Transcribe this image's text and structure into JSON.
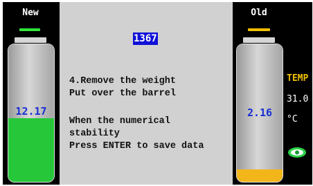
{
  "left_panel": {
    "label": "New",
    "value": "12.17",
    "fill_fraction": 0.46,
    "indicator_color": "#2ee63a",
    "fill_color": "#27c73a",
    "value_color": "#1a2fd4"
  },
  "right_panel": {
    "label": "Old",
    "value": "2.16",
    "fill_fraction": 0.09,
    "indicator_color": "#f0c000",
    "fill_color": "#f3b61a",
    "value_color": "#1a2fd4"
  },
  "center": {
    "counter": "1367",
    "instructions": [
      "4.Remove the weight",
      "Put over the barrel",
      "When the numerical",
      "stability",
      "Press ENTER to save data"
    ]
  },
  "side": {
    "temp_label": "TEMP",
    "temp_value": "31.0",
    "temp_unit": "°C",
    "status_icon": "eye-icon"
  }
}
